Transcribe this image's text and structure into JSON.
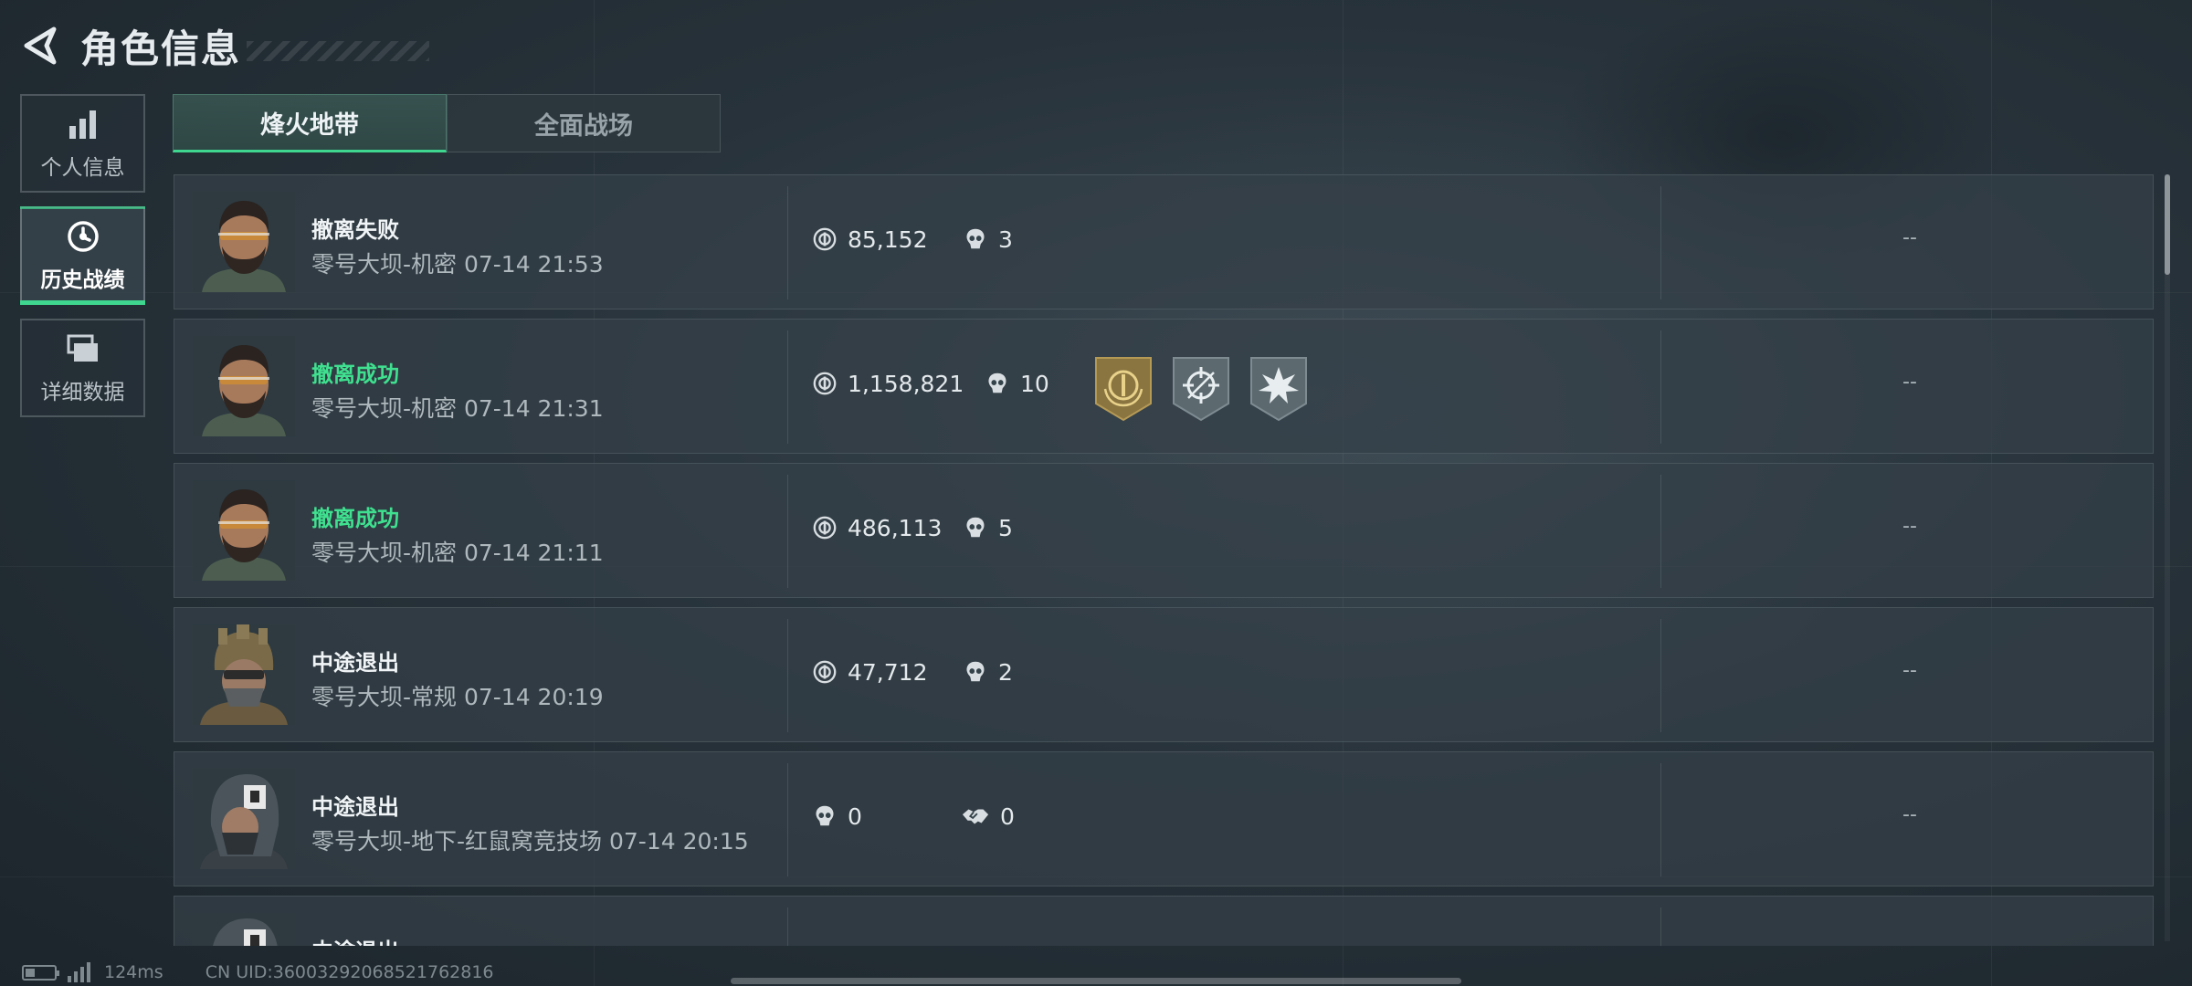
{
  "header": {
    "title": "角色信息"
  },
  "sidebar": {
    "items": [
      {
        "label": "个人信息",
        "icon": "bar-chart-icon",
        "active": false
      },
      {
        "label": "历史战绩",
        "icon": "clock-history-icon",
        "active": true
      },
      {
        "label": "详细数据",
        "icon": "folder-stack-icon",
        "active": false
      }
    ]
  },
  "tabs": [
    {
      "label": "烽火地带",
      "active": true
    },
    {
      "label": "全面战场",
      "active": false
    }
  ],
  "records": [
    {
      "status": "撤离失败",
      "success": false,
      "detail": "零号大坝-机密 07-14 21:53",
      "value": "85,152",
      "kills": "3",
      "extra": "--"
    },
    {
      "status": "撤离成功",
      "success": true,
      "detail": "零号大坝-机密 07-14 21:31",
      "value": "1,158,821",
      "kills": "10",
      "extra": "--"
    },
    {
      "status": "撤离成功",
      "success": true,
      "detail": "零号大坝-机密 07-14 21:11",
      "value": "486,113",
      "kills": "5",
      "extra": "--"
    },
    {
      "status": "中途退出",
      "success": false,
      "detail": "零号大坝-常规 07-14 20:19",
      "value": "47,712",
      "kills": "2",
      "extra": "--"
    },
    {
      "status": "中途退出",
      "success": false,
      "detail": "零号大坝-地下-红鼠窝竞技场 07-14 20:15",
      "kills": "0",
      "assists": "0",
      "extra": "--"
    },
    {
      "status": "中途退出",
      "success": false,
      "detail": "",
      "extra": ""
    }
  ],
  "footer": {
    "ping": "124ms",
    "uid": "CN UID:36003292068521762816"
  },
  "colors": {
    "accent": "#3fd68f",
    "success_text": "#3fe08f"
  }
}
